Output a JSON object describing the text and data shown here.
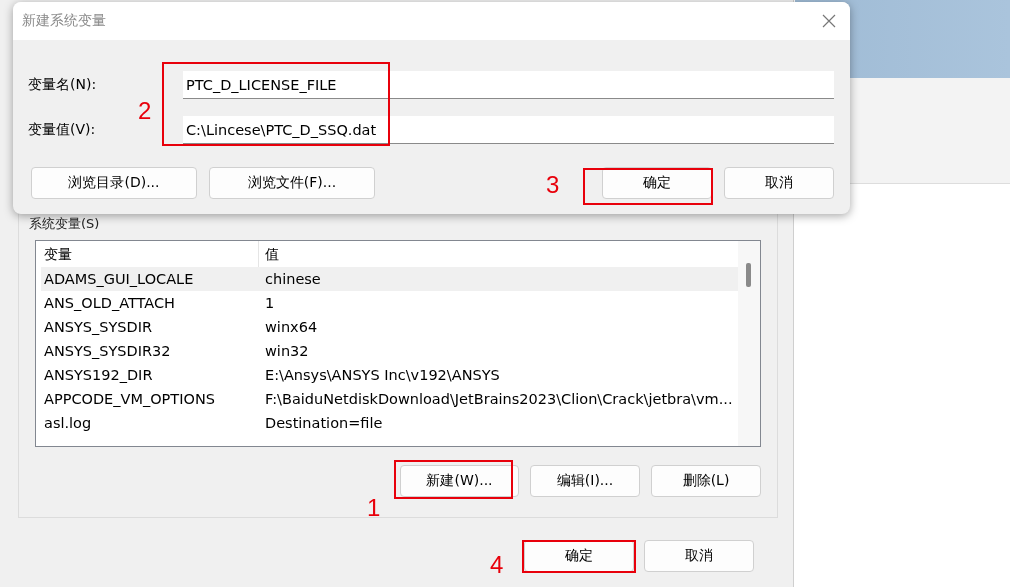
{
  "new_variable_dialog": {
    "title": "新建系统变量",
    "fields": [
      {
        "label": "变量名(N):",
        "value": "PTC_D_LICENSE_FILE"
      },
      {
        "label": "变量值(V):",
        "value": "C:\\Lincese\\PTC_D_SSQ.dat"
      }
    ],
    "fields_callout": "2",
    "left_buttons": [
      {
        "label": "浏览目录(D)..."
      },
      {
        "label": "浏览文件(F)..."
      }
    ],
    "right_buttons": [
      {
        "label": "确定",
        "callout": "3"
      },
      {
        "label": "取消"
      }
    ]
  },
  "environment_window": {
    "group_label": "系统变量(S)",
    "columns": [
      "变量",
      "值"
    ],
    "rows": [
      {
        "name": "ADAMS_GUI_LOCALE",
        "value": "chinese",
        "selected": true
      },
      {
        "name": "ANS_OLD_ATTACH",
        "value": "1",
        "selected": false
      },
      {
        "name": "ANSYS_SYSDIR",
        "value": "winx64",
        "selected": false
      },
      {
        "name": "ANSYS_SYSDIR32",
        "value": "win32",
        "selected": false
      },
      {
        "name": "ANSYS192_DIR",
        "value": "E:\\Ansys\\ANSYS Inc\\v192\\ANSYS",
        "selected": false
      },
      {
        "name": "APPCODE_VM_OPTIONS",
        "value": "F:\\BaiduNetdiskDownload\\JetBrains2023\\Clion\\Crack\\jetbra\\vm...",
        "selected": false
      },
      {
        "name": "asl.log",
        "value": "Destination=file",
        "selected": false
      }
    ],
    "list_buttons": [
      {
        "label": "新建(W)...",
        "callout": "1"
      },
      {
        "label": "编辑(I)..."
      },
      {
        "label": "删除(L)"
      }
    ],
    "buttons": [
      {
        "label": "确定",
        "callout": "4"
      },
      {
        "label": "取消"
      }
    ]
  }
}
